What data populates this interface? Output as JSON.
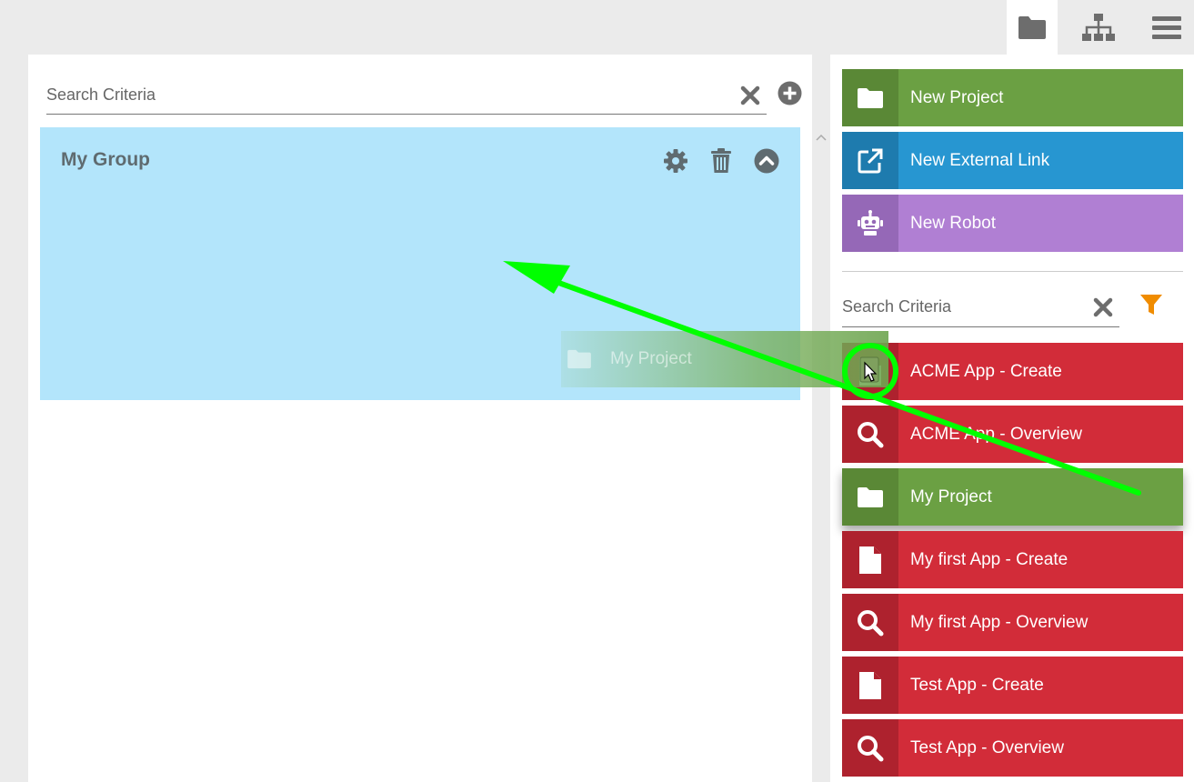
{
  "nav": {
    "items": [
      {
        "name": "folder-icon",
        "active": true
      },
      {
        "name": "sitemap-icon",
        "active": false
      },
      {
        "name": "menu-icon",
        "active": false
      }
    ]
  },
  "left": {
    "search": {
      "placeholder": "Search Criteria"
    },
    "group": {
      "title": "My Group"
    }
  },
  "right": {
    "actions": [
      {
        "label": "New Project",
        "icon": "folder-icon",
        "color": "#6ba043"
      },
      {
        "label": "New External Link",
        "icon": "external-link-icon",
        "color": "#2796d1"
      },
      {
        "label": "New Robot",
        "icon": "robot-icon",
        "color": "#b07fd3"
      }
    ],
    "search": {
      "placeholder": "Search Criteria"
    },
    "items": [
      {
        "label": "ACME App - Create",
        "icon": "file-icon"
      },
      {
        "label": "ACME App - Overview",
        "icon": "search-icon"
      },
      {
        "label": "My Project",
        "icon": "folder-icon"
      },
      {
        "label": "My first App - Create",
        "icon": "file-icon"
      },
      {
        "label": "My first App - Overview",
        "icon": "search-icon"
      },
      {
        "label": "Test App - Create",
        "icon": "file-icon"
      },
      {
        "label": "Test App - Overview",
        "icon": "search-icon"
      }
    ]
  },
  "drag": {
    "label": "My Project"
  },
  "colors": {
    "accent_green": "#6ba043",
    "accent_blue": "#2796d1",
    "accent_purple": "#b07fd3",
    "accent_red": "#d22c39",
    "group_bg": "#b3e5fb",
    "annotation": "#00ff00",
    "filter": "#f08c00"
  }
}
